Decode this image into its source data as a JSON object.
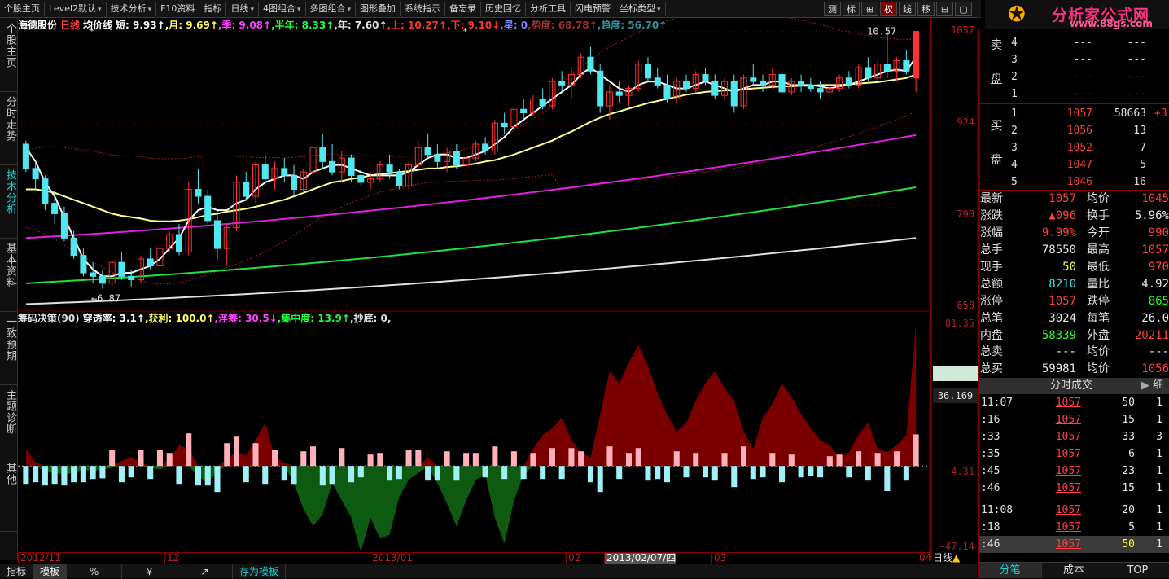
{
  "toolbar": {
    "items": [
      "个股主页",
      "Level2默认",
      "技术分析",
      "F10资料",
      "指标",
      "日线",
      "4图组合",
      "多图组合",
      "图形叠加",
      "系统指示",
      "备忘录",
      "历史回忆",
      "分析工具",
      "闪电预警",
      "坐标类型"
    ],
    "right_buttons": [
      "测",
      "标",
      "⊞",
      "权",
      "线",
      "移",
      "⊟",
      "▢"
    ]
  },
  "logo": {
    "title": "分析家公式网",
    "url": "www.88gs.com"
  },
  "sidebar": {
    "tabs": [
      "个股主页",
      "分时走势",
      "技术分析",
      "基本资料",
      "一致预期",
      "主题诊断",
      "其他"
    ]
  },
  "legend": {
    "stock": "海德股份",
    "period": "日线",
    "indicator_name": "均价线",
    "items": [
      {
        "label": "短:",
        "value": "9.93↑",
        "color": "#ffffff"
      },
      {
        "label": ",月:",
        "value": "9.69↑",
        "color": "#ffff60"
      },
      {
        "label": ",季:",
        "value": "9.08↑",
        "color": "#ff40ff"
      },
      {
        "label": ",半年:",
        "value": "8.33↑",
        "color": "#20ff40"
      },
      {
        "label": ",年:",
        "value": "7.60↑",
        "color": "#e0e0e0"
      },
      {
        "label": ",上:",
        "value": "10.27↑",
        "color": "#ff3030"
      },
      {
        "label": ",下:",
        "value": "9.10↓",
        "color": "#ff3030"
      },
      {
        "label": ",星:",
        "value": "0",
        "color": "#8080ff"
      },
      {
        "label": ",势度:",
        "value": "68.78↑",
        "color": "#a03030"
      },
      {
        "label": ",趋度:",
        "value": "56.70↑",
        "color": "#3090a0"
      }
    ]
  },
  "indicator_legend": {
    "name": "筹码决策(90)",
    "items": [
      {
        "label": "穿透率:",
        "value": "3.1↑",
        "color": "#ffffff"
      },
      {
        "label": ",获利:",
        "value": "100.0↑",
        "color": "#ffff60"
      },
      {
        "label": ",浮筹:",
        "value": "30.5↓",
        "color": "#ff40ff"
      },
      {
        "label": ",集中度:",
        "value": "13.9↑",
        "color": "#20ff40"
      },
      {
        "label": ",抄底:",
        "value": "0",
        "color": "#e0e0e0"
      },
      {
        "label": ",",
        "value": "",
        "color": "#e0e0e0"
      }
    ]
  },
  "chart_annotations": {
    "high_label": "10.57",
    "low_label": "←6.87"
  },
  "price_axis": {
    "labels": [
      "1057",
      "924",
      "790",
      "658"
    ],
    "indicator_labels": [
      "81.35",
      "-4.31",
      "-47.14"
    ],
    "current_value": "36.169"
  },
  "date_axis": {
    "labels": [
      "2012/11",
      "12",
      "2013/01",
      "02",
      "2013/02/07/四",
      "03",
      "04"
    ],
    "period": "日线"
  },
  "bottom_bar": [
    "指标",
    "模板",
    "%",
    "￥",
    "↗",
    "存为模板"
  ],
  "order_book": {
    "sell_label": "卖盘",
    "buy_label": "买盘",
    "sell": [
      {
        "level": "4",
        "price": "---",
        "volume": "---",
        "change": ""
      },
      {
        "level": "3",
        "price": "---",
        "volume": "---",
        "change": ""
      },
      {
        "level": "2",
        "price": "---",
        "volume": "---",
        "change": ""
      },
      {
        "level": "1",
        "price": "---",
        "volume": "---",
        "change": ""
      }
    ],
    "buy": [
      {
        "level": "1",
        "price": "1057",
        "volume": "58663",
        "change": "+3"
      },
      {
        "level": "2",
        "price": "1056",
        "volume": "13",
        "change": ""
      },
      {
        "level": "3",
        "price": "1052",
        "volume": "7",
        "change": ""
      },
      {
        "level": "4",
        "price": "1047",
        "volume": "5",
        "change": ""
      },
      {
        "level": "5",
        "price": "1046",
        "volume": "16",
        "change": ""
      }
    ]
  },
  "stats": [
    {
      "k1": "最新",
      "v1": "1057",
      "c1": "red",
      "k2": "均价",
      "v2": "1045",
      "c2": "red"
    },
    {
      "k1": "涨跌",
      "v1": "▲096",
      "c1": "red",
      "k2": "换手",
      "v2": "5.96%",
      "c2": "wht"
    },
    {
      "k1": "涨幅",
      "v1": "9.99%",
      "c1": "red",
      "k2": "今开",
      "v2": "990",
      "c2": "red"
    },
    {
      "k1": "总手",
      "v1": "78550",
      "c1": "wht",
      "k2": "最高",
      "v2": "1057",
      "c2": "red"
    },
    {
      "k1": "现手",
      "v1": "50",
      "c1": "yel",
      "k2": "最低",
      "v2": "970",
      "c2": "red"
    },
    {
      "k1": "总额",
      "v1": "8210",
      "c1": "cyn",
      "k2": "量比",
      "v2": "4.92",
      "c2": "wht"
    },
    {
      "k1": "涨停",
      "v1": "1057",
      "c1": "red",
      "k2": "跌停",
      "v2": "865",
      "c2": "grn"
    },
    {
      "k1": "总笔",
      "v1": "3024",
      "c1": "wht",
      "k2": "每笔",
      "v2": "26.0",
      "c2": "wht"
    },
    {
      "k1": "内盘",
      "v1": "58339",
      "c1": "grn",
      "k2": "外盘",
      "v2": "20211",
      "c2": "red"
    }
  ],
  "stats2": [
    {
      "k1": "总卖",
      "v1": "---",
      "c1": "wht",
      "k2": "均价",
      "v2": "---",
      "c2": "wht"
    },
    {
      "k1": "总买",
      "v1": "59981",
      "c1": "wht",
      "k2": "均价",
      "v2": "1056",
      "c2": "red"
    }
  ],
  "ticks": {
    "title": "分时成交",
    "detail": "细",
    "rows": [
      {
        "time": "11:07",
        "price": "1057",
        "volume": "50",
        "count": "1"
      },
      {
        "time": ":16",
        "price": "1057",
        "volume": "15",
        "count": "1"
      },
      {
        "time": ":33",
        "price": "1057",
        "volume": "33",
        "count": "3"
      },
      {
        "time": ":35",
        "price": "1057",
        "volume": "6",
        "count": "1"
      },
      {
        "time": ":45",
        "price": "1057",
        "volume": "23",
        "count": "1"
      },
      {
        "time": ":46",
        "price": "1057",
        "volume": "15",
        "count": "1"
      },
      {
        "time": "11:08",
        "price": "1057",
        "volume": "20",
        "count": "1"
      },
      {
        "time": ":18",
        "price": "1057",
        "volume": "5",
        "count": "1"
      },
      {
        "time": ":46",
        "price": "1057",
        "volume": "50",
        "count": "1"
      }
    ]
  },
  "quote_tabs": [
    "分笔",
    "成本",
    "TOP"
  ],
  "colors": {
    "up_candle": "#ff3030",
    "down_candle": "#50e8f0",
    "ma_short": "#ffffff",
    "ma_month": "#ffff90",
    "ma_quarter": "#e020e0",
    "ma_half": "#20e040",
    "ma_year": "#e0e0e0",
    "band": "#a02020",
    "chip_pos": "#7a0000",
    "chip_neg": "#0e5a10"
  },
  "chart_data": {
    "type": "candlestick",
    "note_units": "price in yuan",
    "dates_start": "2012/11",
    "ohlc": [
      [
        8.95,
        9.0,
        8.55,
        8.6
      ],
      [
        8.6,
        8.7,
        8.3,
        8.45
      ],
      [
        8.45,
        8.5,
        8.0,
        8.1
      ],
      [
        8.1,
        8.25,
        7.8,
        7.95
      ],
      [
        7.95,
        8.05,
        7.55,
        7.6
      ],
      [
        7.6,
        7.7,
        7.3,
        7.35
      ],
      [
        7.35,
        7.45,
        7.05,
        7.1
      ],
      [
        7.1,
        7.25,
        6.95,
        7.05
      ],
      [
        7.05,
        7.15,
        6.87,
        6.95
      ],
      [
        6.95,
        7.3,
        6.9,
        7.25
      ],
      [
        7.25,
        7.4,
        7.0,
        7.05
      ],
      [
        7.05,
        7.15,
        6.9,
        7.0
      ],
      [
        7.0,
        7.35,
        6.95,
        7.3
      ],
      [
        7.3,
        7.45,
        7.15,
        7.2
      ],
      [
        7.2,
        7.5,
        7.1,
        7.45
      ],
      [
        7.45,
        7.7,
        7.4,
        7.65
      ],
      [
        7.65,
        7.8,
        7.35,
        7.4
      ],
      [
        7.4,
        8.4,
        7.35,
        8.3
      ],
      [
        8.3,
        8.6,
        8.1,
        8.2
      ],
      [
        8.2,
        8.3,
        7.8,
        7.85
      ],
      [
        7.85,
        8.0,
        7.3,
        7.45
      ],
      [
        7.45,
        7.8,
        7.2,
        7.75
      ],
      [
        7.75,
        8.5,
        7.7,
        8.4
      ],
      [
        8.4,
        8.55,
        8.15,
        8.2
      ],
      [
        8.2,
        8.7,
        8.1,
        8.65
      ],
      [
        8.65,
        8.8,
        8.35,
        8.45
      ],
      [
        8.45,
        8.7,
        8.3,
        8.6
      ],
      [
        8.6,
        8.75,
        8.4,
        8.5
      ],
      [
        8.5,
        8.65,
        8.2,
        8.3
      ],
      [
        8.3,
        8.6,
        8.25,
        8.55
      ],
      [
        8.55,
        9.0,
        8.5,
        8.9
      ],
      [
        8.9,
        9.1,
        8.6,
        8.7
      ],
      [
        8.7,
        8.95,
        8.5,
        8.55
      ],
      [
        8.55,
        8.85,
        8.4,
        8.75
      ],
      [
        8.75,
        8.8,
        8.4,
        8.5
      ],
      [
        8.5,
        8.6,
        8.35,
        8.4
      ],
      [
        8.4,
        8.55,
        8.3,
        8.45
      ],
      [
        8.45,
        8.7,
        8.4,
        8.65
      ],
      [
        8.65,
        8.8,
        8.45,
        8.55
      ],
      [
        8.55,
        8.6,
        8.3,
        8.35
      ],
      [
        8.35,
        8.7,
        8.3,
        8.65
      ],
      [
        8.65,
        9.0,
        8.6,
        8.9
      ],
      [
        8.9,
        9.1,
        8.75,
        8.8
      ],
      [
        8.8,
        8.95,
        8.6,
        8.7
      ],
      [
        8.7,
        8.9,
        8.55,
        8.85
      ],
      [
        8.85,
        8.95,
        8.6,
        8.65
      ],
      [
        8.65,
        8.8,
        8.5,
        8.75
      ],
      [
        8.75,
        9.0,
        8.7,
        8.95
      ],
      [
        8.95,
        9.05,
        8.8,
        8.85
      ],
      [
        8.85,
        9.3,
        8.8,
        9.25
      ],
      [
        9.25,
        9.4,
        9.1,
        9.2
      ],
      [
        9.2,
        9.5,
        9.15,
        9.45
      ],
      [
        9.45,
        9.6,
        9.3,
        9.4
      ],
      [
        9.4,
        9.65,
        9.35,
        9.6
      ],
      [
        9.6,
        9.75,
        9.45,
        9.5
      ],
      [
        9.5,
        9.9,
        9.45,
        9.85
      ],
      [
        9.85,
        10.0,
        9.7,
        9.8
      ],
      [
        9.8,
        10.05,
        9.6,
        9.95
      ],
      [
        9.95,
        10.25,
        9.9,
        10.2
      ],
      [
        10.2,
        10.35,
        9.95,
        10.0
      ],
      [
        10.0,
        10.1,
        9.4,
        9.5
      ],
      [
        9.5,
        9.8,
        9.3,
        9.7
      ],
      [
        9.7,
        9.85,
        9.55,
        9.65
      ],
      [
        9.65,
        9.8,
        9.5,
        9.75
      ],
      [
        9.75,
        10.15,
        9.7,
        10.1
      ],
      [
        10.1,
        10.2,
        9.85,
        9.9
      ],
      [
        9.9,
        10.05,
        9.75,
        9.8
      ],
      [
        9.8,
        9.95,
        9.55,
        9.6
      ],
      [
        9.6,
        9.9,
        9.55,
        9.85
      ],
      [
        9.85,
        9.95,
        9.7,
        9.75
      ],
      [
        9.75,
        10.0,
        9.7,
        9.95
      ],
      [
        9.95,
        10.05,
        9.8,
        9.85
      ],
      [
        9.85,
        9.95,
        9.6,
        9.65
      ],
      [
        9.65,
        9.9,
        9.6,
        9.85
      ],
      [
        9.85,
        9.95,
        9.4,
        9.5
      ],
      [
        9.5,
        9.95,
        9.45,
        9.9
      ],
      [
        9.9,
        10.1,
        9.8,
        9.85
      ],
      [
        9.85,
        9.95,
        9.7,
        9.8
      ],
      [
        9.8,
        10.05,
        9.75,
        9.95
      ],
      [
        9.95,
        10.0,
        9.6,
        9.7
      ],
      [
        9.7,
        9.9,
        9.65,
        9.85
      ],
      [
        9.85,
        9.95,
        9.7,
        9.8
      ],
      [
        9.8,
        9.9,
        9.7,
        9.75
      ],
      [
        9.75,
        9.85,
        9.6,
        9.7
      ],
      [
        9.7,
        9.8,
        9.6,
        9.75
      ],
      [
        9.75,
        9.95,
        9.7,
        9.9
      ],
      [
        9.9,
        10.0,
        9.75,
        9.8
      ],
      [
        9.8,
        10.1,
        9.75,
        10.05
      ],
      [
        10.05,
        10.2,
        9.85,
        9.9
      ],
      [
        9.9,
        10.15,
        9.85,
        10.1
      ],
      [
        10.1,
        10.57,
        9.9,
        10.0
      ],
      [
        10.0,
        10.2,
        9.85,
        10.15
      ],
      [
        10.15,
        10.3,
        9.95,
        10.0
      ],
      [
        9.9,
        10.57,
        9.7,
        10.57
      ]
    ],
    "ma_short": [
      8.9,
      8.7,
      8.4,
      8.2,
      7.9,
      7.6,
      7.3,
      7.15,
      7.05,
      7.05,
      7.1,
      7.1,
      7.15,
      7.2,
      7.3,
      7.45,
      7.6,
      7.85,
      8.0,
      8.05,
      8.0,
      8.0,
      8.1,
      8.15,
      8.3,
      8.4,
      8.45,
      8.5,
      8.5,
      8.45,
      8.55,
      8.6,
      8.65,
      8.65,
      8.6,
      8.55,
      8.5,
      8.5,
      8.5,
      8.5,
      8.55,
      8.65,
      8.75,
      8.8,
      8.8,
      8.75,
      8.75,
      8.8,
      8.85,
      8.95,
      9.05,
      9.2,
      9.3,
      9.4,
      9.5,
      9.6,
      9.7,
      9.8,
      9.95,
      10.05,
      9.95,
      9.85,
      9.75,
      9.7,
      9.8,
      9.85,
      9.85,
      9.8,
      9.75,
      9.75,
      9.8,
      9.85,
      9.8,
      9.75,
      9.7,
      9.75,
      9.8,
      9.8,
      9.85,
      9.85,
      9.8,
      9.8,
      9.8,
      9.78,
      9.75,
      9.78,
      9.8,
      9.85,
      9.9,
      9.95,
      10.0,
      10.02,
      10.0,
      10.2
    ],
    "ma_month": [
      8.3,
      8.3,
      8.28,
      8.25,
      8.2,
      8.15,
      8.1,
      8.05,
      8.0,
      7.95,
      7.92,
      7.9,
      7.88,
      7.85,
      7.84,
      7.84,
      7.85,
      7.87,
      7.9,
      7.93,
      7.95,
      7.98,
      8.0,
      8.02,
      8.05,
      8.08,
      8.12,
      8.15,
      8.2,
      8.25,
      8.3,
      8.35,
      8.4,
      8.42,
      8.45,
      8.47,
      8.5,
      8.52,
      8.53,
      8.55,
      8.56,
      8.58,
      8.6,
      8.6,
      8.62,
      8.63,
      8.65,
      8.67,
      8.7,
      8.72,
      8.76,
      8.8,
      8.85,
      8.9,
      8.95,
      9.0,
      9.07,
      9.13,
      9.2,
      9.27,
      9.33,
      9.38,
      9.42,
      9.46,
      9.5,
      9.54,
      9.57,
      9.6,
      9.63,
      9.66,
      9.68,
      9.7,
      9.71,
      9.72,
      9.73,
      9.74,
      9.75,
      9.76,
      9.77,
      9.78,
      9.78,
      9.79,
      9.79,
      9.8,
      9.8,
      9.8,
      9.81,
      9.82,
      9.83,
      9.84,
      9.86,
      9.88,
      9.9,
      9.95
    ],
    "ma_quarter_range": [
      7.6,
      9.08
    ],
    "ma_half_range": [
      6.95,
      8.33
    ],
    "ma_year_range": [
      6.65,
      7.6
    ],
    "chip_indicator": [
      10,
      2,
      -3,
      -4,
      -5,
      -4,
      -2,
      -3,
      -2,
      -1,
      3,
      5,
      2,
      -1,
      -2,
      4,
      12,
      10,
      -6,
      -10,
      -3,
      4,
      8,
      6,
      15,
      25,
      5,
      2,
      -10,
      -25,
      -35,
      -28,
      -10,
      -20,
      -30,
      -50,
      -30,
      -42,
      -40,
      -18,
      -8,
      -4,
      5,
      -10,
      -22,
      -35,
      -20,
      -8,
      -5,
      -30,
      -45,
      -20,
      -5,
      10,
      18,
      22,
      28,
      15,
      8,
      5,
      30,
      55,
      48,
      60,
      70,
      58,
      42,
      30,
      20,
      25,
      38,
      48,
      55,
      45,
      38,
      20,
      10,
      28,
      36,
      48,
      40,
      30,
      22,
      15,
      12,
      5,
      8,
      18,
      25,
      10,
      8,
      12,
      18,
      82
    ]
  }
}
